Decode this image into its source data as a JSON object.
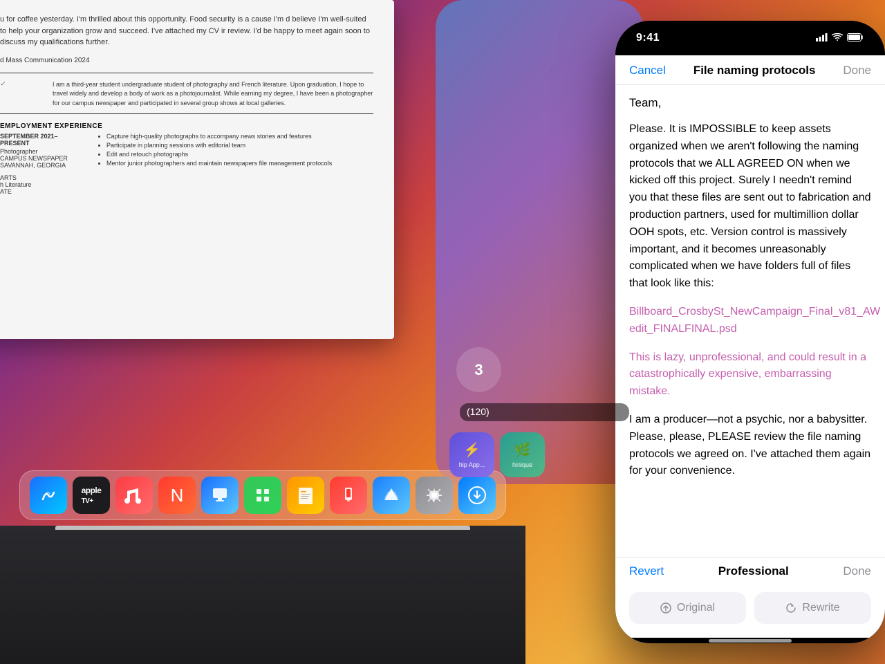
{
  "mac": {
    "desktop_gradient": "orange-purple",
    "document": {
      "intro_text": "u for coffee yesterday. I'm thrilled about this opportunity. Food security is a cause I'm d believe I'm well-suited to help your organization grow and succeed. I've attached my CV ir review. I'd be happy to meet again soon to discuss my qualifications further.",
      "degree_label": "d Mass Communication 2024",
      "bio_text": "I am a third-year student undergraduate student of photography and French literature. Upon graduation, I hope to travel widely and develop a body of work as a photojournalist. While earning my degree, I have been a photographer for our campus newspaper and participated in several group shows at local galleries.",
      "employment_title": "EMPLOYMENT EXPERIENCE",
      "job_date": "SEPTEMBER 2021–PRESENT",
      "job_title": "Photographer",
      "employer": "CAMPUS NEWSPAPER",
      "location": "SAVANNAH, GEORGIA",
      "left_labels": [
        "ARTS",
        "h Literature",
        "ATE"
      ],
      "bullets": [
        "Capture high-quality photographs to accompany news stories and features",
        "Participate in planning sessions with editorial team",
        "Edit and retouch photographs",
        "Mentor junior photographers and maintain newspapers file management protocols"
      ]
    },
    "dock": {
      "icons": [
        {
          "name": "Freeform",
          "key": "freeform",
          "emoji": "✏️"
        },
        {
          "name": "Apple TV",
          "key": "appletv",
          "emoji": "📺"
        },
        {
          "name": "Music",
          "key": "music",
          "emoji": "♪"
        },
        {
          "name": "News",
          "key": "news",
          "emoji": "📰"
        },
        {
          "name": "Keynote",
          "key": "keynote",
          "emoji": "📊"
        },
        {
          "name": "Numbers",
          "key": "numbers",
          "emoji": "📈"
        },
        {
          "name": "Pages",
          "key": "pages",
          "emoji": "📄"
        },
        {
          "name": "iPhone Mirroring",
          "key": "mirroring",
          "emoji": "📱"
        },
        {
          "name": "App Store",
          "key": "appstore",
          "emoji": "⊕"
        },
        {
          "name": "System Settings",
          "key": "settings",
          "emoji": "⚙️"
        },
        {
          "name": "Downloads",
          "key": "downloads",
          "emoji": "⬇️"
        }
      ]
    }
  },
  "iphone": {
    "status_bar": {
      "time": "9:41",
      "signal": "●●●●",
      "wifi": "wifi",
      "battery": "battery"
    },
    "email": {
      "cancel_label": "Cancel",
      "title": "File naming protocols",
      "done_label": "Done",
      "greeting": "Team,",
      "body_paragraph1": "Please. It is IMPOSSIBLE to keep assets organized when we aren't following the naming protocols that we ALL AGREED ON when we kicked off this project. Surely I needn't remind you that these files are sent out to fabrication and production partners, used for multimillion dollar OOH spots, etc. Version control is massively important, and it becomes unreasonably complicated when we have folders full of files that look like this:",
      "file_example": "Billboard_CrosbySt_NewCampaign_Final_v81_AW edit_FINALFINAL.psd",
      "warning_text": "This is lazy, unprofessional, and could result in a catastrophically expensive, embarrassing mistake.",
      "closing_text": "I am a producer—not a psychic, nor a babysitter. Please, please, PLEASE review the file naming protocols we agreed on. I've attached them again for your convenience.",
      "revert_label": "Revert",
      "professional_label": "Professional",
      "bottom_done_label": "Done",
      "original_button": "Original",
      "rewrite_button": "Rewrite"
    }
  },
  "bg_iphone": {
    "notification_number": "3",
    "notification_count": "120",
    "app1_label": "hip App...",
    "app2_label": "hinique"
  }
}
